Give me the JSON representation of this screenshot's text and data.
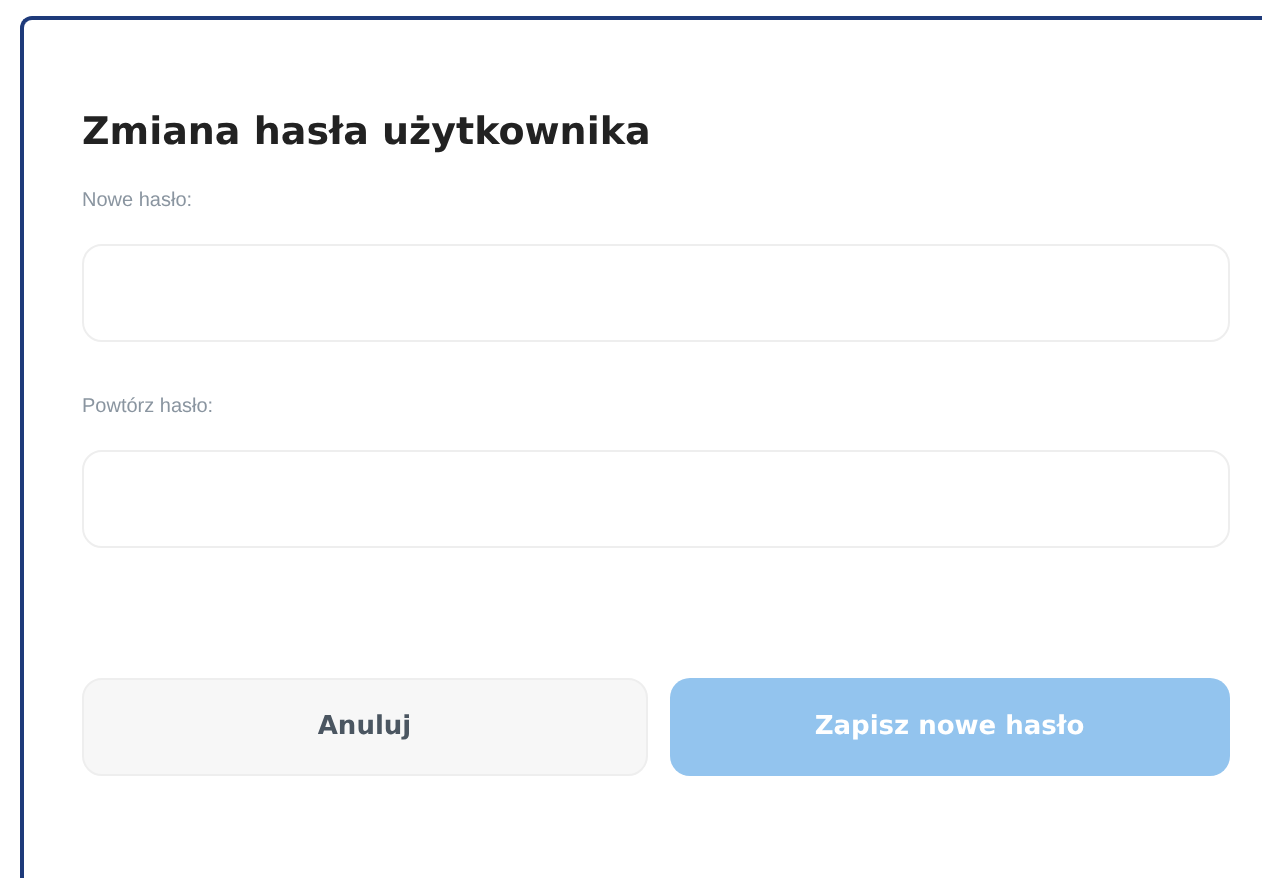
{
  "dialog": {
    "title": "Zmiana hasła użytkownika",
    "fields": [
      {
        "label": "Nowe hasło:"
      },
      {
        "label": "Powtórz hasło:"
      }
    ],
    "buttons": [
      {
        "label": "Anuluj",
        "kind": "secondary",
        "disabled": false
      },
      {
        "label": "Zapisz nowe hasło",
        "kind": "primary",
        "disabled": true
      }
    ]
  }
}
